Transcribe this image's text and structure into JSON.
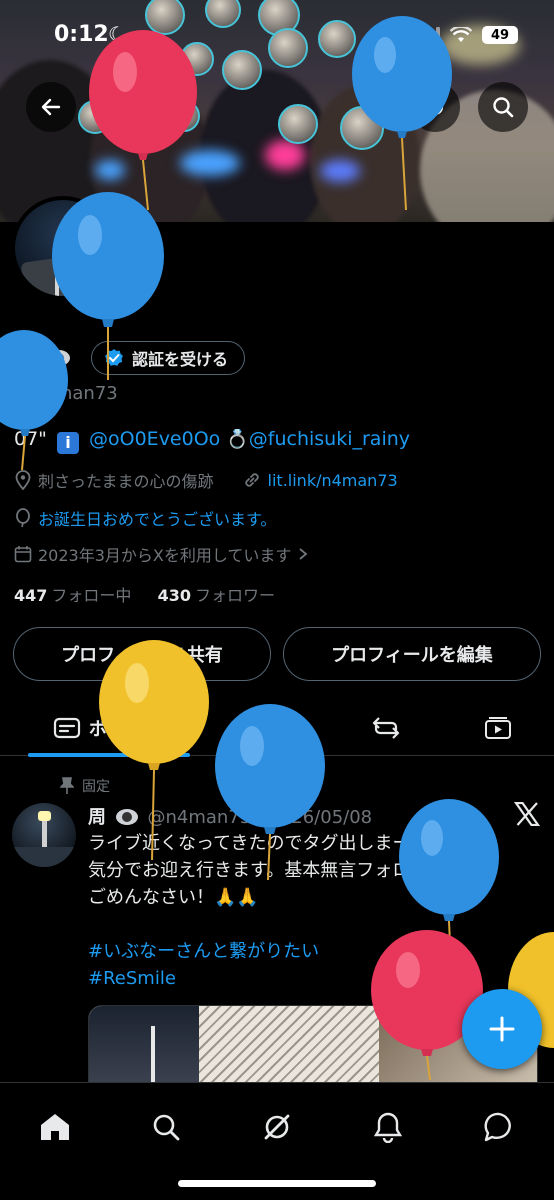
{
  "status_bar": {
    "time": "0:12",
    "battery": "49"
  },
  "profile": {
    "display_name": "周",
    "handle": "@n4man73",
    "verify_button": "認証を受ける",
    "bio": {
      "prefix": "07\"",
      "mention_1": "@oO0Eve0Oo",
      "mention_2": "@fuchisuki_rainy"
    },
    "location": "刺さったままの心の傷跡",
    "website": "lit.link/n4man73",
    "birthday": "お誕生日おめでとうございます。",
    "joined": "2023年3月からXを利用しています",
    "following_count": "447",
    "following_label": "フォロー中",
    "followers_count": "430",
    "followers_label": "フォロワー"
  },
  "actions": {
    "share": "プロフィールを共有",
    "edit": "プロフィールを編集"
  },
  "tabs": {
    "posts_label": "ポスト"
  },
  "pinned_post": {
    "pinned_label": "固定",
    "author": "周",
    "handle_date": "@n4man73 · 2026/05/08",
    "lines": [
      "ライブ近くなってきたのでタグ出しまーす！",
      "気分でお迎え行きます。基本無言フォローです。",
      "ごめんなさい！🙏🙏"
    ],
    "hashtags": [
      "#いぶなーさんと繋がりたい",
      "#ReSmile"
    ]
  },
  "colors": {
    "accent": "#1d9bf0",
    "background": "#000000",
    "muted": "#71767b",
    "balloon_red": "#e8375a",
    "balloon_blue": "#2f8fe0",
    "balloon_yellow": "#f0c12a"
  },
  "icons": [
    "back-arrow-icon",
    "refresh-icon",
    "search-icon",
    "verified-badge-icon",
    "location-icon",
    "link-icon",
    "balloon-icon",
    "calendar-icon",
    "chevron-right-icon",
    "posts-icon",
    "chevron-down-icon",
    "repost-icon",
    "video-icon",
    "pin-icon",
    "x-logo-icon",
    "plus-icon",
    "home-icon",
    "grok-icon",
    "bell-icon",
    "message-icon"
  ]
}
